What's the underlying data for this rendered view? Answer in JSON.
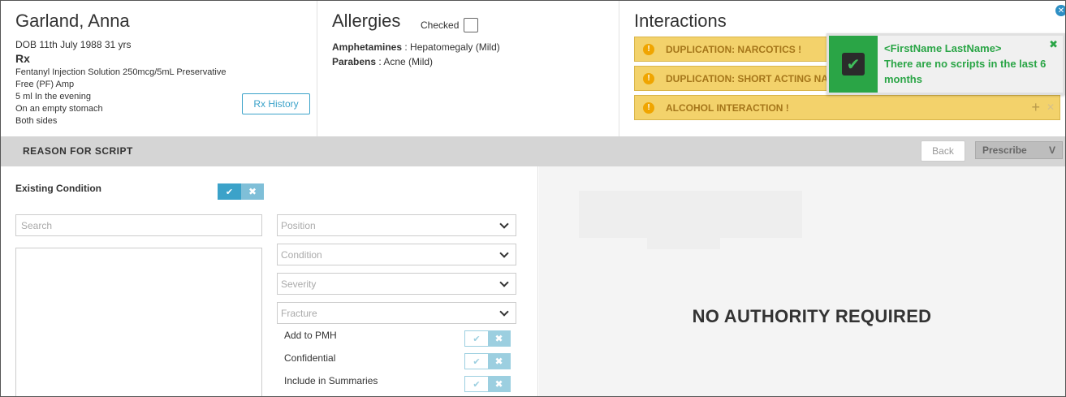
{
  "patient": {
    "name": "Garland, Anna",
    "dob": "DOB 11th July 1988 31 yrs",
    "rx_title": "Rx",
    "rx_lines": [
      "Fentanyl Injection Solution 250mcg/5mL Preservative Free (PF) Amp",
      "5 ml In the evening",
      "On an empty stomach",
      "Both sides"
    ],
    "rx_history_label": "Rx History"
  },
  "allergies": {
    "title": "Allergies",
    "checked_label": "Checked",
    "checked": false,
    "items": [
      {
        "substance": "Amphetamines",
        "reaction": " : Hepatomegaly (Mild)"
      },
      {
        "substance": "Parabens",
        "reaction": " : Acne (Mild)"
      }
    ]
  },
  "interactions": {
    "title": "Interactions",
    "items": [
      {
        "label": "DUPLICATION: NARCOTICS !"
      },
      {
        "label": "DUPLICATION: SHORT ACTING NARCOTICS !"
      },
      {
        "label": "ALCOHOL INTERACTION !"
      }
    ],
    "warning_icon": "exclamation-icon"
  },
  "toast": {
    "name": "<FirstName LastName>",
    "message": "There are no scripts in the last 6 months",
    "icon": "checkbox-checked-icon",
    "color": "#2aa546"
  },
  "reason_bar": {
    "title": "REASON FOR SCRIPT",
    "back_label": "Back",
    "prescribe_label": "Prescribe",
    "prescribe_caret": "V"
  },
  "form": {
    "existing_condition_label": "Existing Condition",
    "search_placeholder": "Search",
    "selects": [
      {
        "placeholder": "Position"
      },
      {
        "placeholder": "Condition"
      },
      {
        "placeholder": "Severity"
      },
      {
        "placeholder": "Fracture"
      }
    ],
    "options": [
      {
        "label": "Add to PMH"
      },
      {
        "label": "Confidential"
      },
      {
        "label": "Include in Summaries"
      }
    ],
    "toggle_on_symbol": "✔",
    "toggle_off_symbol": "✖"
  },
  "authority": {
    "status": "NO AUTHORITY REQUIRED"
  },
  "colors": {
    "accent": "#3ba2c9",
    "warning_bg": "#f3d26b",
    "success": "#2aa546"
  }
}
